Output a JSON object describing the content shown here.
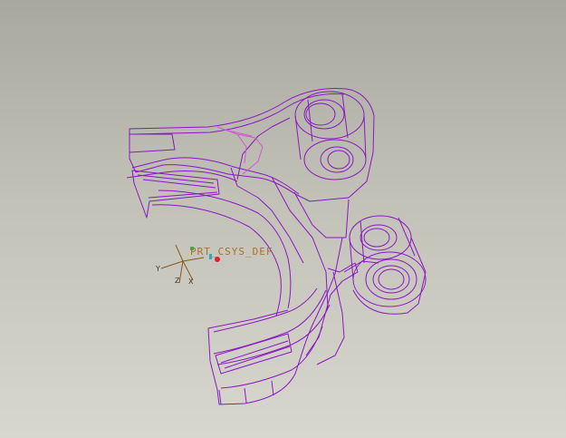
{
  "viewport": {
    "background_top": "#a9a89f",
    "background_bottom": "#d8d7cf",
    "wireframe_color": "#8a18c2",
    "highlight_color": "#d255d2"
  },
  "csys": {
    "label": "PRT_CSYS_DEF",
    "color": "#a9702e",
    "axis_x": "X",
    "axis_y": "Y",
    "axis_z": "Z"
  }
}
